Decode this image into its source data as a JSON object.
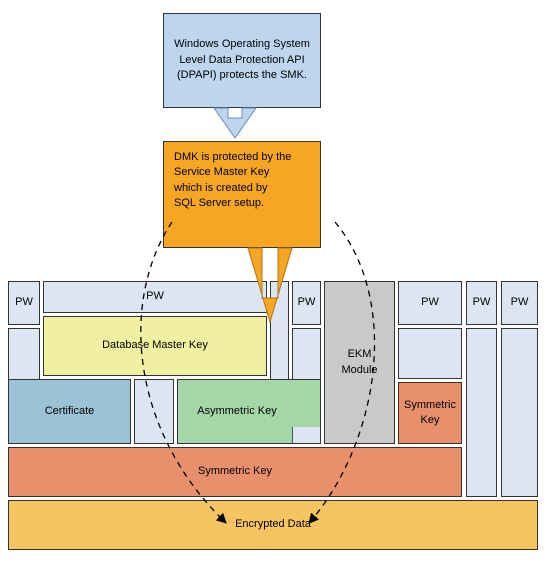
{
  "top_blue": "Windows Operating System Level Data Protection API (DPAPI) protects the SMK.",
  "orange_box": "DMK is protected by the Service Master Key which is created by SQL Server setup.",
  "pw": "PW",
  "dmk": "Database Master Key",
  "cert": "Certificate",
  "asym": "Asymmetric Key",
  "ekm": "EKM Module",
  "sym_small": "Symmetric Key",
  "sym_large": "Symmetric Key",
  "enc": "Encrypted Data",
  "colors": {
    "blue_top": "#BDD6EE",
    "orange": "#F5A623",
    "pw": "#DCE6F2",
    "dmk": "#F0F0A0",
    "cert": "#9BC2D6",
    "asym": "#A5D6A7",
    "ekm": "#C9C9C9",
    "sym": "#E8906B",
    "enc": "#F5C562"
  }
}
